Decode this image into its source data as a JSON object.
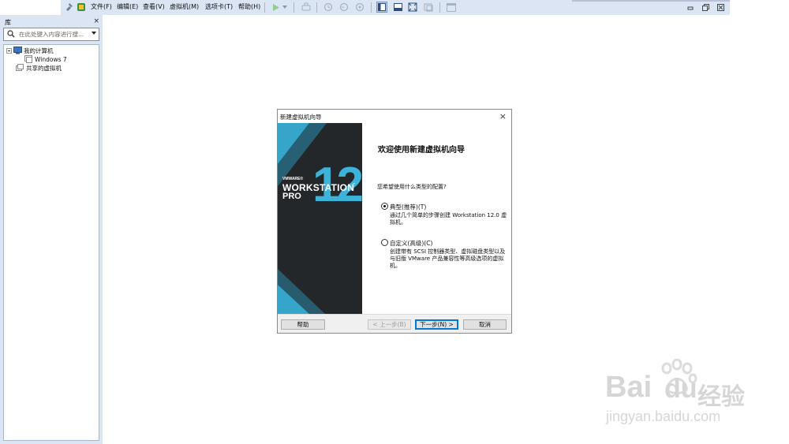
{
  "toolbar": {
    "menus": [
      "文件(F)",
      "编辑(E)",
      "查看(V)",
      "虚拟机(M)",
      "选项卡(T)",
      "帮助(H)"
    ],
    "icons": [
      "pin-icon",
      "vm-app-icon",
      "play-icon",
      "dropdown-icon",
      "send-keys-icon",
      "snapshot-icon",
      "revert-snapshot-icon",
      "snapshot-manager-icon",
      "sidebar-view-icon",
      "thumbnail-view-icon",
      "fullscreen-icon",
      "unity-icon",
      "console-view-icon"
    ],
    "window_controls": [
      "minimize",
      "restore",
      "close"
    ]
  },
  "library": {
    "title": "库",
    "close": "×",
    "search_placeholder": "在此处键入内容进行搜...",
    "tree": {
      "root": "我的计算机",
      "vm": "Windows 7",
      "shared": "共享的虚拟机"
    }
  },
  "dialog": {
    "title": "新建虚拟机向导",
    "close": "×",
    "banner": {
      "brand": "VMWARE®",
      "product": "WORKSTATION",
      "edition": "PRO",
      "version": "12",
      "tm": "™"
    },
    "heading": "欢迎使用新建虚拟机向导",
    "question": "您希望使用什么类型的配置?",
    "options": [
      {
        "label": "典型(推荐)(T)",
        "desc": "通过几个简单的步骤创建 Workstation 12.0 虚拟机。",
        "selected": true
      },
      {
        "label": "自定义(高级)(C)",
        "desc": "创建带有 SCSI 控制器类型、虚拟磁盘类型以及与旧版 VMware 产品兼容性等高级选项的虚拟机。",
        "selected": false
      }
    ],
    "buttons": {
      "help": "帮助",
      "back": "< 上一步(B)",
      "next": "下一步(N) >",
      "cancel": "取消"
    }
  },
  "watermark": {
    "brand": "Bai",
    "brand2": "du",
    "jingyan": "经验",
    "url": "jingyan.baidu.com"
  },
  "colors": {
    "chrome": "#dbe5f3",
    "banner_dark": "#24272a",
    "banner_teal": "#35a6c9",
    "focus_blue": "#0078d7"
  }
}
